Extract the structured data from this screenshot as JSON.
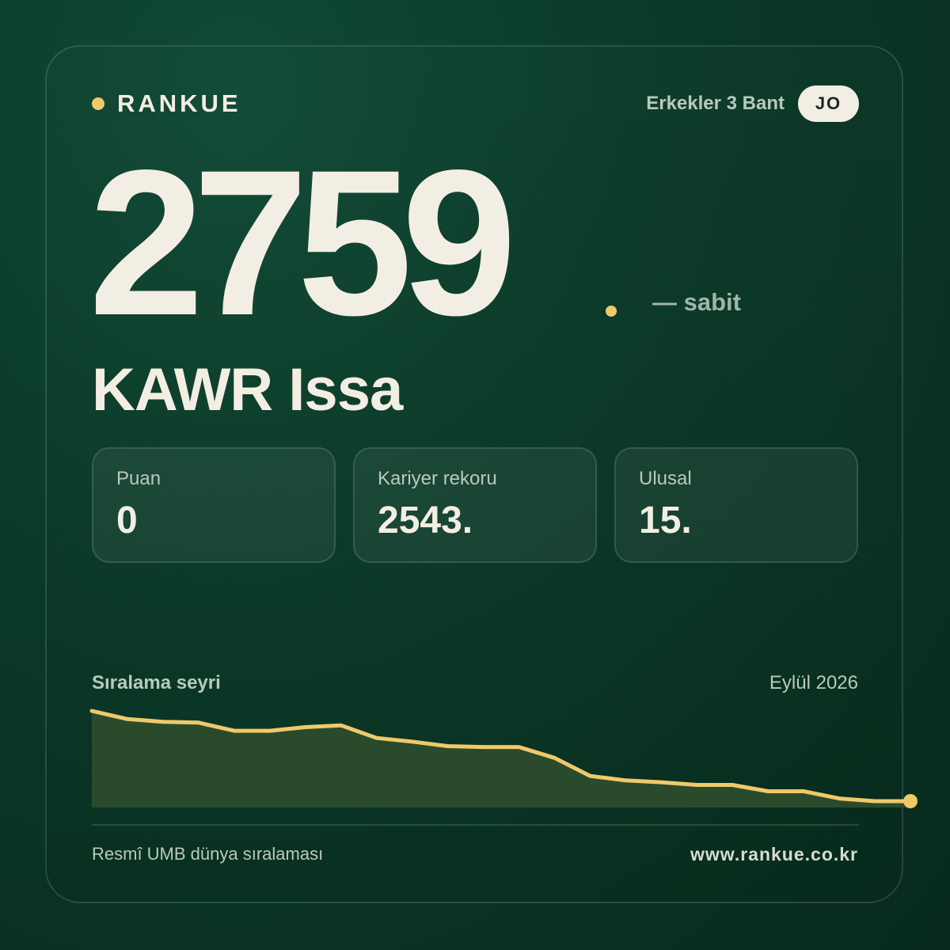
{
  "brand": {
    "name": "RANKUE"
  },
  "header": {
    "category": "Erkekler 3 Bant",
    "country_code": "JO"
  },
  "player": {
    "rank": "2759",
    "trend": "— sabit",
    "name": "KAWR Issa"
  },
  "stats": [
    {
      "label": "Puan",
      "value": "0"
    },
    {
      "label": "Kariyer rekoru",
      "value": "2543."
    },
    {
      "label": "Ulusal",
      "value": "15."
    }
  ],
  "history": {
    "title": "Sıralama seyri",
    "date": "Eylül 2026"
  },
  "footer": {
    "source": "Resmî UMB dünya sıralaması",
    "url": "www.rankue.co.kr"
  },
  "colors": {
    "accent": "#f0c96a",
    "text_primary": "#f3eee3",
    "background": "#0b3a29"
  },
  "chart_data": {
    "type": "area",
    "title": "Sıralama seyri",
    "xlabel": "",
    "ylabel": "",
    "values": [
      0.0,
      0.09,
      0.12,
      0.13,
      0.22,
      0.22,
      0.18,
      0.16,
      0.3,
      0.34,
      0.39,
      0.4,
      0.4,
      0.52,
      0.72,
      0.77,
      0.79,
      0.82,
      0.82,
      0.89,
      0.89,
      0.97,
      1.0,
      1.0
    ],
    "grid": false,
    "legend": "none"
  }
}
